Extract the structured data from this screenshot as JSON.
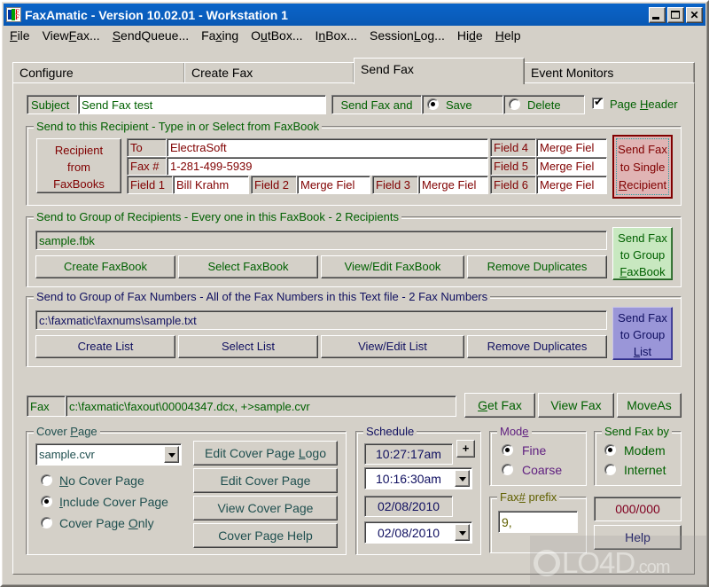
{
  "window": {
    "title": "FaxAmatic - Version 10.02.01 - Workstation 1",
    "icon": "faxamatic-logo-icon",
    "minimize": "_",
    "maximize": "□",
    "close": "×"
  },
  "menubar": {
    "items": [
      {
        "label": "File",
        "accel": "F"
      },
      {
        "label": "ViewFax...",
        "accel": "F"
      },
      {
        "label": "SendQueue...",
        "accel": "S"
      },
      {
        "label": "Faxing",
        "accel": "x"
      },
      {
        "label": "OutBox...",
        "accel": "u"
      },
      {
        "label": "InBox...",
        "accel": "n"
      },
      {
        "label": "SessionLog...",
        "accel": "L"
      },
      {
        "label": "Hide",
        "accel": "d"
      },
      {
        "label": "Help",
        "accel": "H"
      }
    ]
  },
  "tabs": [
    {
      "label": "Configure",
      "active": false
    },
    {
      "label": "Create Fax",
      "active": false
    },
    {
      "label": "Send Fax",
      "active": true
    },
    {
      "label": "Event Monitors",
      "active": false
    }
  ],
  "subject_row": {
    "subject_label": "Subject",
    "subject_value": "Send Fax test",
    "send_fax_and_label": "Send Fax and",
    "save_label": "Save",
    "save_selected": true,
    "delete_label": "Delete",
    "delete_selected": false,
    "page_header_label": "Page Header",
    "page_header_checked": true
  },
  "recipient": {
    "group_title": "Send to this Recipient - Type in or Select from FaxBook",
    "faxbooks_button": "Recipient\nfrom\nFaxBooks",
    "faxbooks_button_lines": [
      "Recipient",
      "from",
      "FaxBooks"
    ],
    "to_label": "To",
    "to_value": "ElectraSoft",
    "fax_label": "Fax #",
    "fax_value": "1-281-499-5939",
    "fields": [
      {
        "label": "Field 1",
        "value": "Bill Krahm"
      },
      {
        "label": "Field 2",
        "value": "Merge Fiel"
      },
      {
        "label": "Field 3",
        "value": "Merge Fiel"
      },
      {
        "label": "Field 4",
        "value": "Merge Fiel"
      },
      {
        "label": "Field 5",
        "value": "Merge Fiel"
      },
      {
        "label": "Field 6",
        "value": "Merge Fiel"
      }
    ],
    "send_button_lines": [
      "Send Fax",
      "to Single",
      "Recipient"
    ],
    "send_button_accel": "R"
  },
  "group_faxbook": {
    "group_title": "Send to Group of Recipients - Every one in this FaxBook - 2 Recipients",
    "path_value": "sample.fbk",
    "buttons": [
      "Create FaxBook",
      "Select FaxBook",
      "View/Edit FaxBook",
      "Remove Duplicates"
    ],
    "send_button_lines": [
      "Send Fax",
      "to Group",
      "FaxBook"
    ],
    "send_button_accel": "F"
  },
  "group_list": {
    "group_title": "Send to Group of Fax Numbers - All of the Fax Numbers in this Text file - 2 Fax Numbers",
    "path_value": "c:\\faxmatic\\faxnums\\sample.txt",
    "buttons": [
      "Create List",
      "Select List",
      "View/Edit List",
      "Remove Duplicates"
    ],
    "send_button_lines": [
      "Send Fax",
      "to Group",
      "List"
    ],
    "send_button_accel": "L"
  },
  "fax_row": {
    "fax_label": "Fax",
    "fax_path": "c:\\faxmatic\\faxout\\00004347.dcx, +>sample.cvr",
    "get_fax": "Get Fax",
    "get_fax_accel": "G",
    "view_fax": "View Fax",
    "move_as": "MoveAs"
  },
  "cover_page": {
    "group_title": "Cover Page",
    "group_title_accel": "P",
    "selected_file": "sample.cvr",
    "options": [
      {
        "label": "No Cover Page",
        "accel": "N",
        "selected": false
      },
      {
        "label": "Include Cover Page",
        "accel": "I",
        "selected": true
      },
      {
        "label": "Cover Page Only",
        "accel": "O",
        "selected": false
      }
    ],
    "buttons": [
      {
        "label": "Edit Cover Page Logo",
        "accel": "L"
      },
      {
        "label": "Edit Cover Page",
        "accel": ""
      },
      {
        "label": "View Cover Page",
        "accel": ""
      },
      {
        "label": "Cover Page Help",
        "accel": ""
      }
    ]
  },
  "schedule": {
    "group_title": "Schedule",
    "current_time": "10:27:17am",
    "plus_button": "+",
    "scheduled_time": "10:16:30am",
    "current_date": "02/08/2010",
    "scheduled_date": "02/08/2010"
  },
  "mode": {
    "group_title": "Mode",
    "group_title_accel": "e",
    "options": [
      {
        "label": "Fine",
        "selected": true
      },
      {
        "label": "Coarse",
        "selected": false
      }
    ]
  },
  "send_by": {
    "group_title": "Send Fax by",
    "options": [
      {
        "label": "Modem",
        "selected": true
      },
      {
        "label": "Internet",
        "selected": false
      }
    ]
  },
  "fax_prefix": {
    "group_title": "Fax# prefix",
    "group_title_accel": "#",
    "value": "9,"
  },
  "counter": {
    "value": "000/000"
  },
  "help_button": {
    "label": "Help"
  },
  "watermark": {
    "text": "LO4D",
    "suffix": ".com"
  },
  "colors": {
    "title_bar": "#0a5fc0",
    "face": "#d4d0c8",
    "green_text": "#006000",
    "maroon_text": "#800000",
    "teal_text": "#1f4f4f",
    "purple_text": "#602080",
    "olive_text": "#606000",
    "navy_text": "#101060",
    "counter_red": "#800020"
  }
}
